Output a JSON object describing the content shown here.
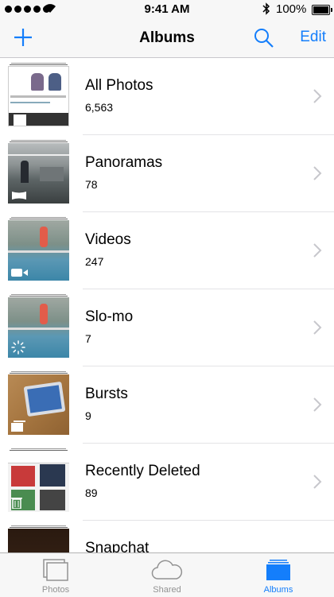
{
  "status_bar": {
    "time": "9:41 AM",
    "battery_pct": "100%"
  },
  "nav": {
    "title": "Albums",
    "edit_label": "Edit"
  },
  "albums": [
    {
      "title": "All Photos",
      "count": "6,563"
    },
    {
      "title": "Panoramas",
      "count": "78"
    },
    {
      "title": "Videos",
      "count": "247"
    },
    {
      "title": "Slo-mo",
      "count": "7"
    },
    {
      "title": "Bursts",
      "count": "9"
    },
    {
      "title": "Recently Deleted",
      "count": "89"
    },
    {
      "title": "Snapchat",
      "count": ""
    }
  ],
  "tabs": [
    {
      "label": "Photos",
      "active": false
    },
    {
      "label": "Shared",
      "active": false
    },
    {
      "label": "Albums",
      "active": true
    }
  ],
  "colors": {
    "accent": "#147efb",
    "inactive": "#929292",
    "bar_bg": "#f7f7f7"
  }
}
